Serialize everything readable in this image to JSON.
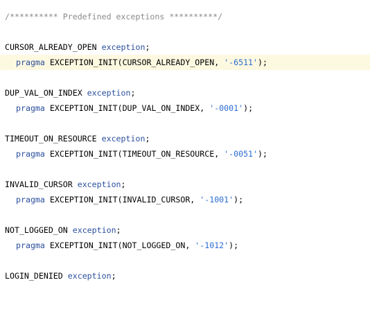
{
  "editor": {
    "current_line_color": "#fdf8e0",
    "colors": {
      "keyword": "#2b4f9c",
      "string": "#2a6bd0",
      "comment": "#8a8a8a",
      "text": "#000000"
    },
    "lines": [
      {
        "comment": "/********** Predefined exceptions **********/"
      },
      {
        "name": "CURSOR_ALREADY_OPEN",
        "keyword": "exception",
        "end": ";"
      },
      {
        "pragma": "pragma",
        "call": "EXCEPTION_INIT(CURSOR_ALREADY_OPEN, ",
        "code": "'-6511'",
        "close": ");"
      },
      {
        "name": "DUP_VAL_ON_INDEX",
        "keyword": "exception",
        "end": ";"
      },
      {
        "pragma": "pragma",
        "call": "EXCEPTION_INIT(DUP_VAL_ON_INDEX, ",
        "code": "'-0001'",
        "close": ");"
      },
      {
        "name": "TIMEOUT_ON_RESOURCE",
        "keyword": "exception",
        "end": ";"
      },
      {
        "pragma": "pragma",
        "call": "EXCEPTION_INIT(TIMEOUT_ON_RESOURCE, ",
        "code": "'-0051'",
        "close": ");"
      },
      {
        "name": "INVALID_CURSOR",
        "keyword": "exception",
        "end": ";"
      },
      {
        "pragma": "pragma",
        "call": "EXCEPTION_INIT(INVALID_CURSOR, ",
        "code": "'-1001'",
        "close": ");"
      },
      {
        "name": "NOT_LOGGED_ON",
        "keyword": "exception",
        "end": ";"
      },
      {
        "pragma": "pragma",
        "call": "EXCEPTION_INIT(NOT_LOGGED_ON, ",
        "code": "'-1012'",
        "close": ");"
      },
      {
        "name": "LOGIN_DENIED",
        "keyword": "exception",
        "end": ";"
      }
    ]
  }
}
